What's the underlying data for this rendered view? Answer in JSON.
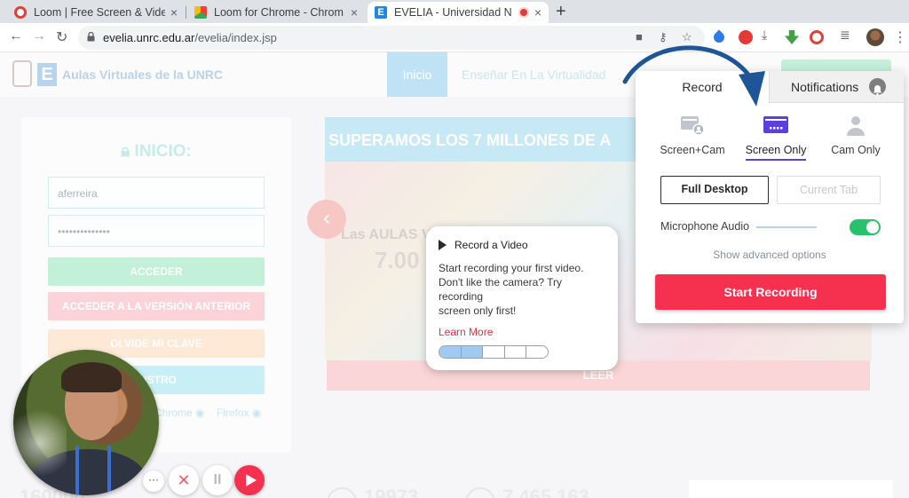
{
  "browser": {
    "tabs": [
      {
        "title": "Loom | Free Screen & Vide",
        "icon": "loom-icon",
        "active": false
      },
      {
        "title": "Loom for Chrome - Chrom",
        "icon": "chrome-store-icon",
        "active": false
      },
      {
        "title": "EVELIA - Universidad N",
        "icon": "evelia-icon",
        "active": true
      }
    ],
    "close_glyph": "×",
    "new_tab_glyph": "+",
    "url_host": "evelia.unrc.edu.ar",
    "url_path": "/evelia/index.jsp",
    "colors": {
      "tabbar": "#dee1e6",
      "omnibox": "#f1f3f4"
    }
  },
  "site": {
    "title": "Aulas Virtuales de la UNRC",
    "logo_letter": "E",
    "nav": [
      "Inicio",
      "Enseñar En La Virtualidad"
    ],
    "login": {
      "title": "INICIO:",
      "username": "aferreira",
      "password": "••••••••••••••",
      "buttons": [
        "ACCEDER",
        "ACCEDER A LA VERSIÓN ANTERIOR",
        "OLVIDE MI CLAVE",
        "GISTRO"
      ],
      "browsers": [
        "Chrome",
        "Firefox"
      ]
    },
    "carousel": {
      "headline": "SUPERAMOS LOS 7 MILLONES DE A",
      "faint_line1": "Las AULAS V",
      "faint_line2": "7.00",
      "cta": "LEER",
      "prev_glyph": "‹"
    },
    "stats_faint": [
      "160000",
      "19973",
      "7.465.163"
    ]
  },
  "loom_tip": {
    "title": "Record a Video",
    "body_lines": [
      "Start recording your first video.",
      "Don't like the camera? Try",
      "recording",
      "screen only first!"
    ],
    "link": "Learn More",
    "progress_steps_total": 5,
    "progress_steps_done": 2
  },
  "loom_popup": {
    "tabs": {
      "record": "Record",
      "notifications": "Notifications"
    },
    "modes": [
      {
        "label": "Screen+Cam",
        "icon": "screen-cam-icon",
        "active": false
      },
      {
        "label": "Screen Only",
        "icon": "screen-only-icon",
        "active": true
      },
      {
        "label": "Cam Only",
        "icon": "cam-only-icon",
        "active": false
      }
    ],
    "scope": {
      "full": "Full Desktop",
      "tab": "Current Tab"
    },
    "mic_label": "Microphone Audio",
    "mic_enabled": true,
    "advanced": "Show advanced options",
    "start": "Start Recording",
    "colors": {
      "accent": "#5b3fe0",
      "start": "#f63150",
      "toggle_on": "#27c36b"
    }
  },
  "loom_controls": {
    "more_glyph": "···",
    "cancel_glyph": "✕",
    "pause_glyph": "II"
  }
}
